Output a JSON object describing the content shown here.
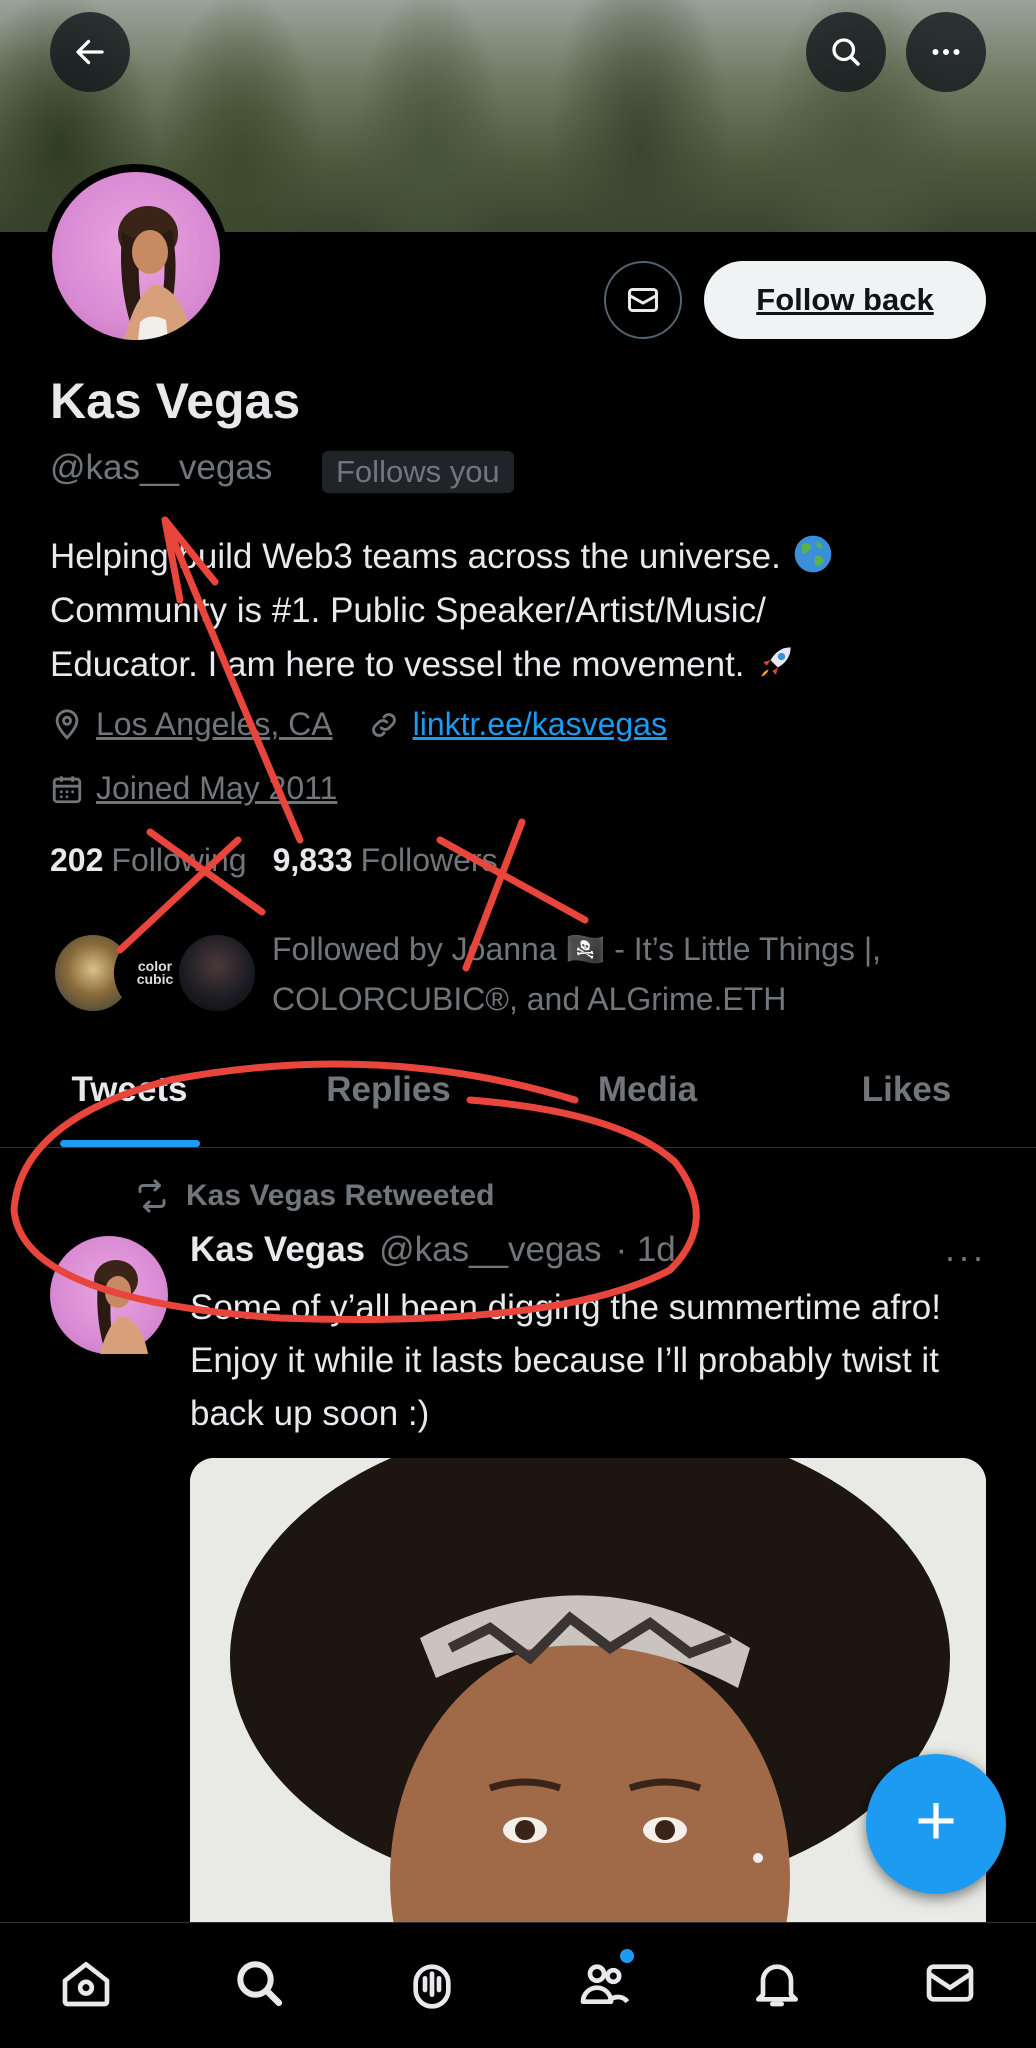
{
  "header": {
    "back_icon": "arrow-left-icon",
    "search_icon": "search-icon",
    "more_icon": "more-horizontal-icon"
  },
  "profile": {
    "name": "Kas Vegas",
    "handle": "@kas__vegas",
    "follows_you": "Follows you",
    "follow_back_label": "Follow back",
    "bio_line1": "Helping build Web3 teams across the universe. ",
    "bio_line2": "Community is #1. Public Speaker/Artist/Music/",
    "bio_line3": "Educator. I am here to vessel the movement. ",
    "location": "Los Angeles, CA",
    "website": "linktr.ee/kasvegas",
    "joined": "Joined May 2011",
    "following_count": "202",
    "following_label": "Following",
    "followers_count": "9,833",
    "followers_label": "Followers",
    "followed_by": "Followed by Joanna 🏴‍☠️ - It’s Little Things |, COLORCUBIC®, and ALGrime.ETH",
    "colorcubic_logo_text": "color cubic"
  },
  "tabs": {
    "tweets": "Tweets",
    "replies": "Replies",
    "media": "Media",
    "likes": "Likes"
  },
  "tweet": {
    "retweeted_label": "Kas Vegas Retweeted",
    "author": "Kas Vegas",
    "handle": "@kas__vegas",
    "time": "· 1d",
    "more": "···",
    "text": "Some of y’all been digging the summertime afro! Enjoy it while it lasts because I’ll probably twist it back up soon :)"
  },
  "fab_label": "+",
  "colors": {
    "accent": "#1d9bf0",
    "annotation_red": "#e8453c",
    "background": "#000000"
  }
}
